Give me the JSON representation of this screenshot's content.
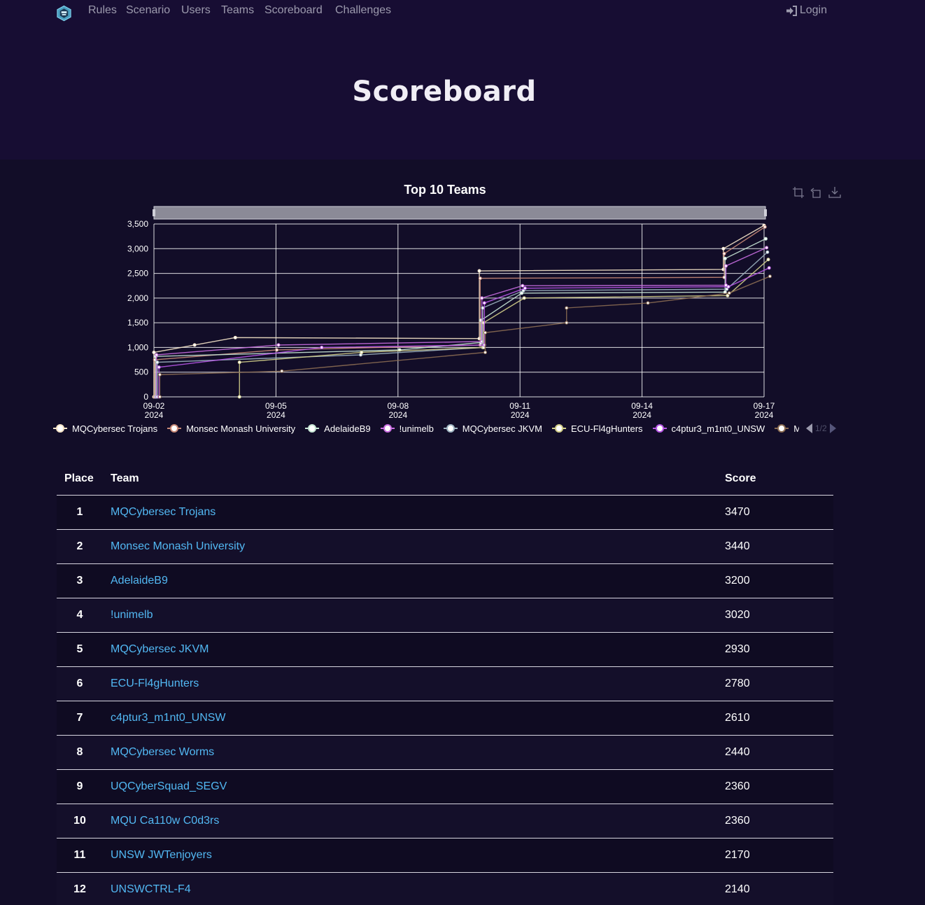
{
  "nav": {
    "items": [
      "Rules",
      "Scenario",
      "Users",
      "Teams",
      "Scoreboard",
      "Challenges"
    ],
    "login_label": "Login",
    "brand_icon": "shield-logo-icon"
  },
  "hero": {
    "title": "Scoreboard"
  },
  "chart": {
    "title": "Top 10 Teams",
    "legend_page": "1/2",
    "toolbox": [
      "zoom-icon",
      "reset-zoom-icon",
      "download-icon"
    ]
  },
  "chart_data": {
    "type": "line",
    "title": "Top 10 Teams",
    "xlabel": "",
    "ylabel": "",
    "ylim": [
      0,
      3500
    ],
    "yticks": [
      "0",
      "500",
      "1,000",
      "1,500",
      "2,000",
      "2,500",
      "3,000",
      "3,500"
    ],
    "xticks": [
      {
        "date": "09-02",
        "year": "2024"
      },
      {
        "date": "09-05",
        "year": "2024"
      },
      {
        "date": "09-08",
        "year": "2024"
      },
      {
        "date": "09-11",
        "year": "2024"
      },
      {
        "date": "09-14",
        "year": "2024"
      },
      {
        "date": "09-17",
        "year": "2024"
      }
    ],
    "xlim": [
      "2024-09-02",
      "2024-09-17"
    ],
    "grid": true,
    "legend_placement": "bottom",
    "series": [
      {
        "name": "MQCybersec Trojans",
        "color": "#f5e4c8",
        "points": [
          [
            "2024-09-02",
            0
          ],
          [
            "2024-09-02",
            900
          ],
          [
            "2024-09-03",
            1050
          ],
          [
            "2024-09-04",
            1200
          ],
          [
            "2024-09-10",
            1180
          ],
          [
            "2024-09-10",
            2550
          ],
          [
            "2024-09-16",
            2580
          ],
          [
            "2024-09-16",
            3000
          ],
          [
            "2024-09-17",
            3470
          ]
        ]
      },
      {
        "name": "Monsec Monash University",
        "color": "#c98a78",
        "points": [
          [
            "2024-09-02",
            0
          ],
          [
            "2024-09-02",
            750
          ],
          [
            "2024-09-05",
            950
          ],
          [
            "2024-09-10",
            1050
          ],
          [
            "2024-09-10",
            2400
          ],
          [
            "2024-09-16",
            2420
          ],
          [
            "2024-09-16",
            2900
          ],
          [
            "2024-09-17",
            3440
          ]
        ]
      },
      {
        "name": "AdelaideB9",
        "color": "#c7e6d5",
        "points": [
          [
            "2024-09-02",
            0
          ],
          [
            "2024-09-02",
            820
          ],
          [
            "2024-09-08",
            950
          ],
          [
            "2024-09-10",
            1100
          ],
          [
            "2024-09-10",
            1550
          ],
          [
            "2024-09-11",
            2100
          ],
          [
            "2024-09-16",
            2120
          ],
          [
            "2024-09-16",
            2800
          ],
          [
            "2024-09-17",
            3200
          ]
        ]
      },
      {
        "name": "!unimelb",
        "color": "#c86de0",
        "points": [
          [
            "2024-09-02",
            0
          ],
          [
            "2024-09-02",
            850
          ],
          [
            "2024-09-05",
            1050
          ],
          [
            "2024-09-10",
            1120
          ],
          [
            "2024-09-10",
            2000
          ],
          [
            "2024-09-11",
            2250
          ],
          [
            "2024-09-16",
            2260
          ],
          [
            "2024-09-16",
            2650
          ],
          [
            "2024-09-17",
            3020
          ]
        ]
      },
      {
        "name": "MQCybersec JKVM",
        "color": "#9fb5c2",
        "points": [
          [
            "2024-09-02",
            0
          ],
          [
            "2024-09-02",
            700
          ],
          [
            "2024-09-07",
            850
          ],
          [
            "2024-09-10",
            1000
          ],
          [
            "2024-09-10",
            1800
          ],
          [
            "2024-09-11",
            2150
          ],
          [
            "2024-09-16",
            2180
          ],
          [
            "2024-09-17",
            2930
          ]
        ]
      },
      {
        "name": "ECU-Fl4gHunters",
        "color": "#d3cf8a",
        "points": [
          [
            "2024-09-04",
            0
          ],
          [
            "2024-09-04",
            700
          ],
          [
            "2024-09-07",
            900
          ],
          [
            "2024-09-10",
            1000
          ],
          [
            "2024-09-10",
            1500
          ],
          [
            "2024-09-11",
            2000
          ],
          [
            "2024-09-16",
            2050
          ],
          [
            "2024-09-17",
            2780
          ]
        ]
      },
      {
        "name": "c4ptur3_m1nt0_UNSW",
        "color": "#b756e6",
        "points": [
          [
            "2024-09-02",
            0
          ],
          [
            "2024-09-02",
            600
          ],
          [
            "2024-09-06",
            1000
          ],
          [
            "2024-09-10",
            1050
          ],
          [
            "2024-09-10",
            1900
          ],
          [
            "2024-09-11",
            2200
          ],
          [
            "2024-09-16",
            2230
          ],
          [
            "2024-09-17",
            2610
          ]
        ]
      },
      {
        "name": "MQCybersec Worms",
        "color": "#8b6c52",
        "points": [
          [
            "2024-09-02",
            0
          ],
          [
            "2024-09-02",
            450
          ],
          [
            "2024-09-05",
            520
          ],
          [
            "2024-09-10",
            900
          ],
          [
            "2024-09-10",
            1300
          ],
          [
            "2024-09-12",
            1500
          ],
          [
            "2024-09-12",
            1800
          ],
          [
            "2024-09-14",
            1900
          ],
          [
            "2024-09-16",
            2100
          ],
          [
            "2024-09-17",
            2440
          ]
        ]
      }
    ]
  },
  "table": {
    "headers": {
      "place": "Place",
      "team": "Team",
      "score": "Score"
    },
    "rows": [
      {
        "place": "1",
        "team": "MQCybersec Trojans",
        "score": "3470"
      },
      {
        "place": "2",
        "team": "Monsec Monash University",
        "score": "3440"
      },
      {
        "place": "3",
        "team": "AdelaideB9",
        "score": "3200"
      },
      {
        "place": "4",
        "team": "!unimelb",
        "score": "3020"
      },
      {
        "place": "5",
        "team": "MQCybersec JKVM",
        "score": "2930"
      },
      {
        "place": "6",
        "team": "ECU-Fl4gHunters",
        "score": "2780"
      },
      {
        "place": "7",
        "team": "c4ptur3_m1nt0_UNSW",
        "score": "2610"
      },
      {
        "place": "8",
        "team": "MQCybersec Worms",
        "score": "2440"
      },
      {
        "place": "9",
        "team": "UQCyberSquad_SEGV",
        "score": "2360"
      },
      {
        "place": "10",
        "team": "MQU Ca110w C0d3rs",
        "score": "2360"
      },
      {
        "place": "11",
        "team": "UNSW JWTenjoyers",
        "score": "2170"
      },
      {
        "place": "12",
        "team": "UNSWCTRL-F4",
        "score": "2140"
      }
    ]
  }
}
